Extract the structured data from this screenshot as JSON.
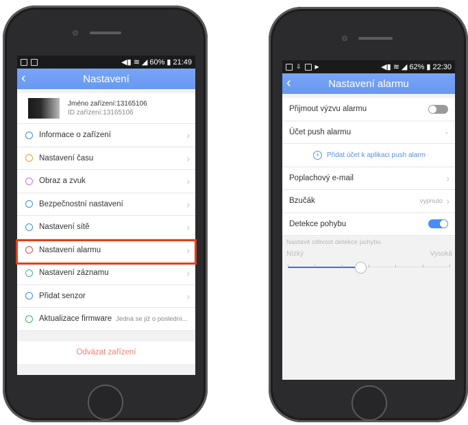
{
  "left_screen": {
    "status": {
      "battery": "60%",
      "time": "21:49"
    },
    "title": "Nastavení",
    "device": {
      "name": "Jméno zařízení:13165106",
      "id": "ID zařízení:13165106"
    },
    "menu": [
      {
        "label": "Informace o zařízení",
        "icon": "info-icon",
        "color": "#3a8ee6"
      },
      {
        "label": "Nastavení času",
        "icon": "clock-icon",
        "color": "#f0a020"
      },
      {
        "label": "Obraz a zvuk",
        "icon": "image-sound-icon",
        "color": "#d070e0"
      },
      {
        "label": "Bezpečnostní nastavení",
        "icon": "shield-icon",
        "color": "#3a8ee6"
      },
      {
        "label": "Nastavení sítě",
        "icon": "wifi-icon",
        "color": "#3a8ee6"
      },
      {
        "label": "Nastavení alarmu",
        "icon": "alarm-icon",
        "color": "#e64a3a"
      },
      {
        "label": "Nastavení záznamu",
        "icon": "record-icon",
        "color": "#3ab0a0"
      },
      {
        "label": "Přidat senzor",
        "icon": "sensor-icon",
        "color": "#3a8ee6"
      },
      {
        "label": "Aktualizace firmware",
        "icon": "firmware-icon",
        "color": "#3ab060",
        "value": "Jedná se již o poslední..."
      }
    ],
    "unbind_label": "Odvázat zařízení"
  },
  "right_screen": {
    "status": {
      "battery": "62%",
      "time": "22:30"
    },
    "title": "Nastavení alarmu",
    "receive_alarm": {
      "label": "Přijmout výzvu alarmu",
      "on": false
    },
    "push_account": {
      "label": "Účet push alarmu"
    },
    "add_push": {
      "label": "Přidat účet k aplikaci push alarm"
    },
    "email": {
      "label": "Poplachový e-mail"
    },
    "buzzer": {
      "label": "Bzučák",
      "value": "vypnuto"
    },
    "motion": {
      "label": "Detekce pohybu",
      "on": true
    },
    "sensitivity_label": "Nastavit citlivost detekce pohybu",
    "slider": {
      "min_label": "Nízký",
      "max_label": "Vysoká",
      "level": 0.45
    }
  }
}
